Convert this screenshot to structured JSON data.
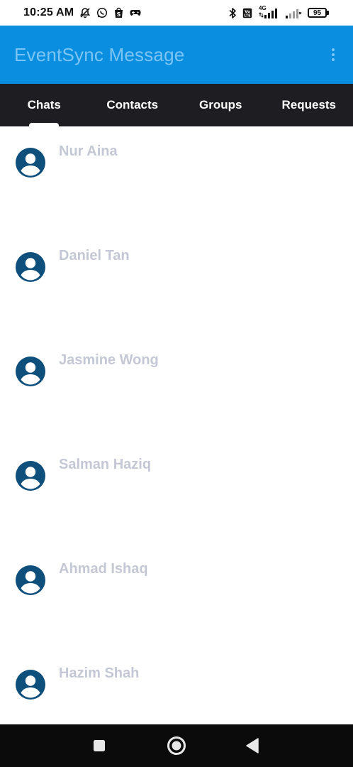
{
  "status_bar": {
    "time": "10:25 AM",
    "battery": "95",
    "network": "4G",
    "icons": [
      "mute-bell-icon",
      "whatsapp-icon",
      "shopee-icon",
      "game-controller-icon",
      "bluetooth-icon",
      "volte-icon",
      "signal-icon",
      "signal-weak-icon",
      "battery-icon"
    ]
  },
  "app_bar": {
    "title": "EventSync Message",
    "menu_icon": "more-vert-icon"
  },
  "tabs": [
    {
      "label": "Chats",
      "selected": true
    },
    {
      "label": "Contacts",
      "selected": false
    },
    {
      "label": "Groups",
      "selected": false
    },
    {
      "label": "Requests",
      "selected": false
    }
  ],
  "chats": [
    {
      "name": "Nur Aina",
      "avatar": "person-avatar-icon"
    },
    {
      "name": "Daniel Tan",
      "avatar": "person-avatar-icon"
    },
    {
      "name": "Jasmine Wong",
      "avatar": "person-avatar-icon"
    },
    {
      "name": "Salman Haziq",
      "avatar": "person-avatar-icon"
    },
    {
      "name": "Ahmad Ishaq",
      "avatar": "person-avatar-icon"
    },
    {
      "name": "Hazim Shah",
      "avatar": "person-avatar-icon"
    }
  ],
  "nav_bar": {
    "buttons": [
      "recents-square-icon",
      "home-circle-icon",
      "back-triangle-icon"
    ]
  },
  "colors": {
    "app_bar": "#0a8fe0",
    "app_title": "#7cc4f3",
    "tab_bar": "#1e1e22",
    "chat_name": "#c3c8d4",
    "avatar": "#0e4f7b"
  }
}
